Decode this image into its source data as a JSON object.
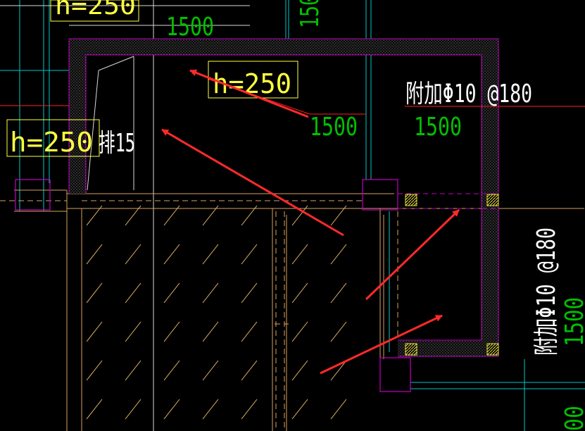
{
  "drawing": {
    "colors": {
      "background": "#000000",
      "wall_magenta": "#c000c0",
      "slab_yellow_label": "#ffff40",
      "dimension_green": "#00c000",
      "cyan": "#00c8c8",
      "orange": "#d8a060",
      "red_line": "#ff2020",
      "arrow": "#ff2a2a",
      "white_text": "#ffffff",
      "hatch": "#f0c060"
    },
    "labels": {
      "top_partial_h": "h=250",
      "top_dim_1500": "1500",
      "slab_h_main": "h=250",
      "slab_dim_left": "1500",
      "slab_dim_right": "1500",
      "rebar_top": "附加Φ10 @180",
      "left_h": "h=250",
      "left_note": "排15",
      "rebar_right": "附加Φ10 @180",
      "right_dim_1500": "1500",
      "right_dim_bottom": "00",
      "top_right_partial": "150"
    }
  }
}
